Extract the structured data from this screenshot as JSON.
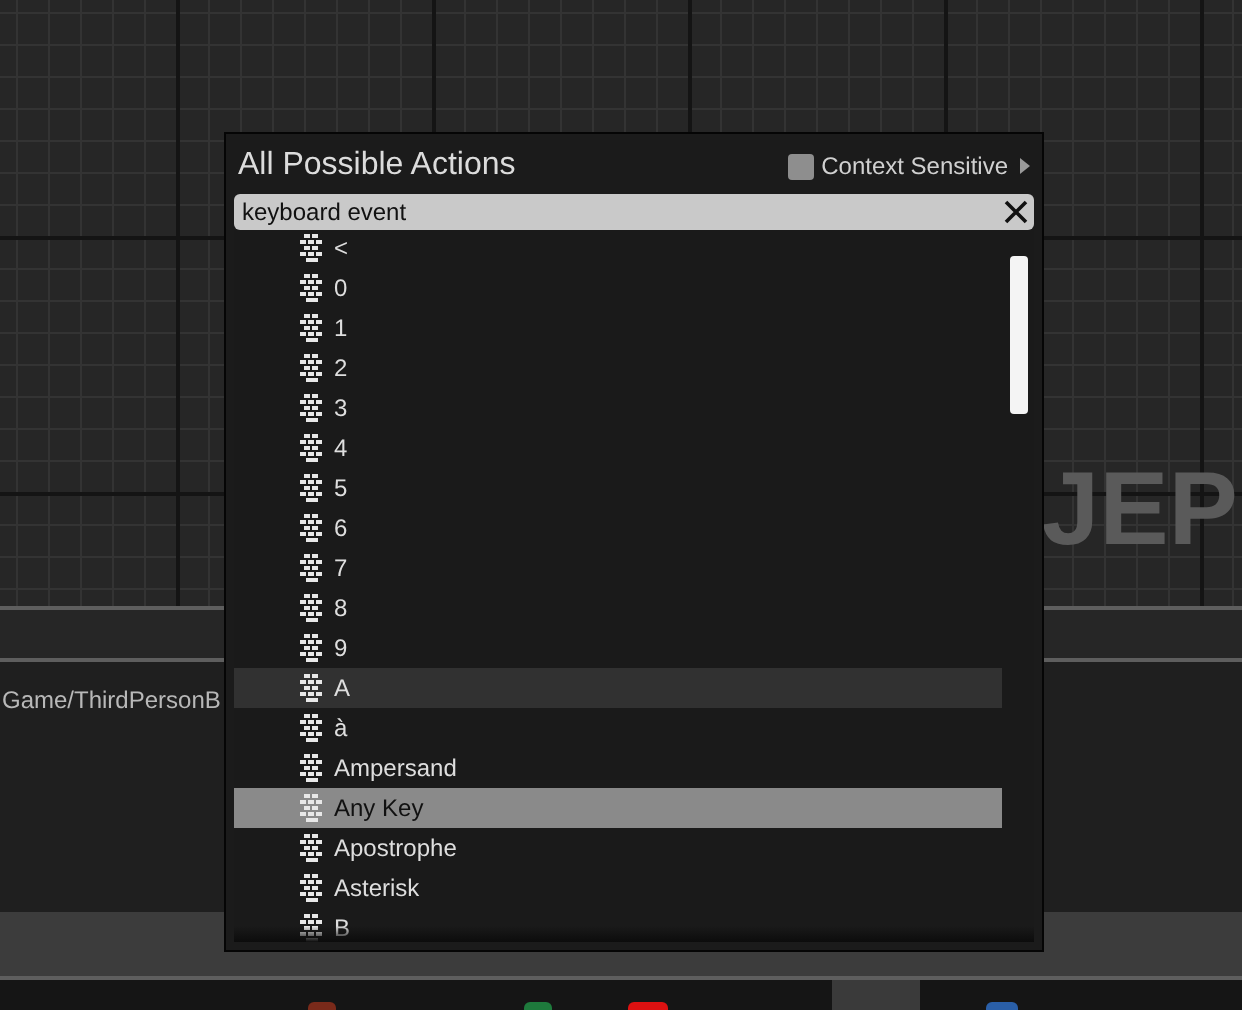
{
  "graph": {
    "watermark": "JEP"
  },
  "details_panel": {
    "path": "Game/ThirdPersonB"
  },
  "action_menu": {
    "title": "All Possible Actions",
    "context_sensitive": {
      "label": "Context Sensitive",
      "checked": false
    },
    "search": {
      "value": "keyboard event"
    },
    "items": [
      {
        "label": "<",
        "selected": false,
        "hovered": false
      },
      {
        "label": "0",
        "selected": false,
        "hovered": false
      },
      {
        "label": "1",
        "selected": false,
        "hovered": false
      },
      {
        "label": "2",
        "selected": false,
        "hovered": false
      },
      {
        "label": "3",
        "selected": false,
        "hovered": false
      },
      {
        "label": "4",
        "selected": false,
        "hovered": false
      },
      {
        "label": "5",
        "selected": false,
        "hovered": false
      },
      {
        "label": "6",
        "selected": false,
        "hovered": false
      },
      {
        "label": "7",
        "selected": false,
        "hovered": false
      },
      {
        "label": "8",
        "selected": false,
        "hovered": false
      },
      {
        "label": "9",
        "selected": false,
        "hovered": false
      },
      {
        "label": "A",
        "selected": false,
        "hovered": true
      },
      {
        "label": "à",
        "selected": false,
        "hovered": false
      },
      {
        "label": "Ampersand",
        "selected": false,
        "hovered": false
      },
      {
        "label": "Any Key",
        "selected": true,
        "hovered": false
      },
      {
        "label": "Apostrophe",
        "selected": false,
        "hovered": false
      },
      {
        "label": "Asterisk",
        "selected": false,
        "hovered": false
      },
      {
        "label": "B",
        "selected": false,
        "hovered": false
      }
    ]
  }
}
